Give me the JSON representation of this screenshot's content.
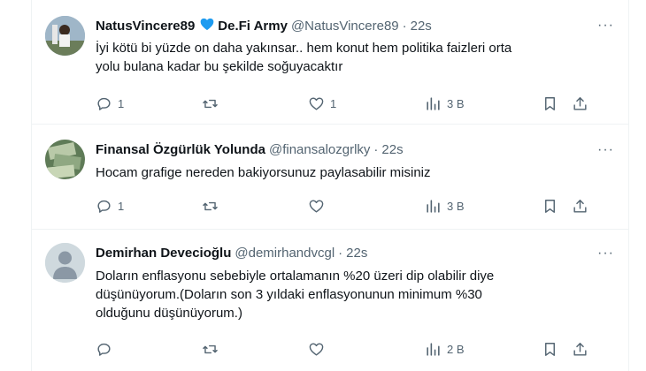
{
  "tweets": [
    {
      "name": "NatusVincere89",
      "suffix": "De.Fi Army",
      "handle": "@NatusVincere89",
      "dot": "·",
      "time": "22s",
      "text_lines": [
        "İyi kötü bi yüzde on daha yakınsar.. hem konut hem politika faizleri orta",
        "yolu bulana kadar bu şekilde soğuyacaktır"
      ],
      "replies": "1",
      "retweets": "",
      "likes": "1",
      "views": "3 B"
    },
    {
      "name": "Finansal Özgürlük Yolunda",
      "handle": "@finansalozgrlky",
      "dot": "·",
      "time": "22s",
      "text_lines": [
        "Hocam grafige nereden bakiyorsunuz paylasabilir misiniz"
      ],
      "replies": "1",
      "retweets": "",
      "likes": "",
      "views": "3 B"
    },
    {
      "name": "Demirhan Devecioğlu",
      "handle": "@demirhandvcgl",
      "dot": "·",
      "time": "22s",
      "text_lines": [
        "Doların enflasyonu sebebiyle ortalamanın %20 üzeri dip olabilir diye",
        "düşünüyorum.(Doların son 3 yıldaki enflasyonunun  minimum %30",
        "olduğunu düşünüyorum.)"
      ],
      "replies": "",
      "retweets": "",
      "likes": "",
      "views": "2 B"
    }
  ],
  "more_label": "···",
  "colors": {
    "verified_heart": "#1d9bf0",
    "muted": "#536471",
    "text": "#0f1419"
  }
}
